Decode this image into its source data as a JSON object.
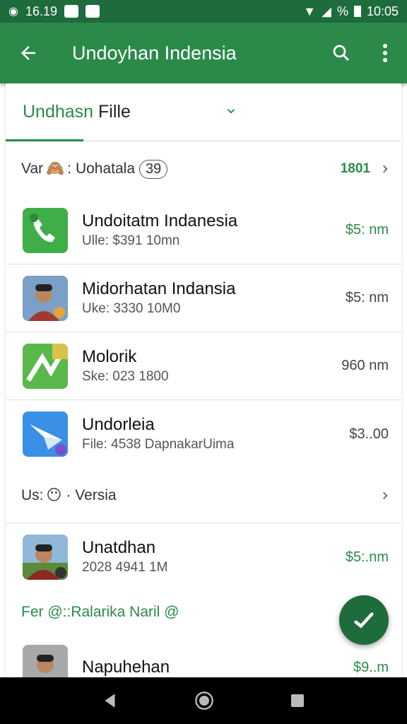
{
  "status_bar": {
    "left_time": "16.19",
    "battery_pct": "%",
    "clock": "10:05"
  },
  "app_bar": {
    "title": "Undoyhan Indensia"
  },
  "tab": {
    "label_green": "Undhasn",
    "label_dark": "Fille"
  },
  "section1": {
    "label": "Var",
    "emoji": "🙈",
    "text": ": Uohatala",
    "badge": "39",
    "value": "1801"
  },
  "apps": [
    {
      "name": "Undoitatm Indanesia",
      "sub": "Ulle: $391 10mn",
      "size": "$5: nm",
      "size_green": true,
      "icon": "phone-app-icon"
    },
    {
      "name": "Midorhatan Indansia",
      "sub": "Uke: 3330 10M0",
      "size": "$5: nm",
      "size_green": false,
      "icon": "profile-photo-icon"
    },
    {
      "name": "Molorik",
      "sub": "Ske: 023 1800",
      "size": "960 nm",
      "size_green": false,
      "icon": "maps-app-icon"
    },
    {
      "name": "Undorleia",
      "sub": "File: 4538 DapnakarUima",
      "size": "$3..00",
      "size_green": false,
      "icon": "send-app-icon"
    }
  ],
  "section2": {
    "label": "Us:",
    "emoji": "😶",
    "text": "· Versia"
  },
  "apps2": [
    {
      "name": "Unatdhan",
      "sub": "2028 4941 1M",
      "size": "$5:.nm",
      "size_green": true,
      "icon": "profile-photo-icon"
    }
  ],
  "link_row": {
    "text": "Fer @::Ralarika Naril @"
  },
  "apps3": [
    {
      "name": "Napuhehan",
      "sub": "",
      "size": "$9..m",
      "size_green": true,
      "icon": "profile-photo-icon"
    }
  ],
  "colors": {
    "primary": "#2b8a4a",
    "primary_dark": "#1e6b3c"
  }
}
